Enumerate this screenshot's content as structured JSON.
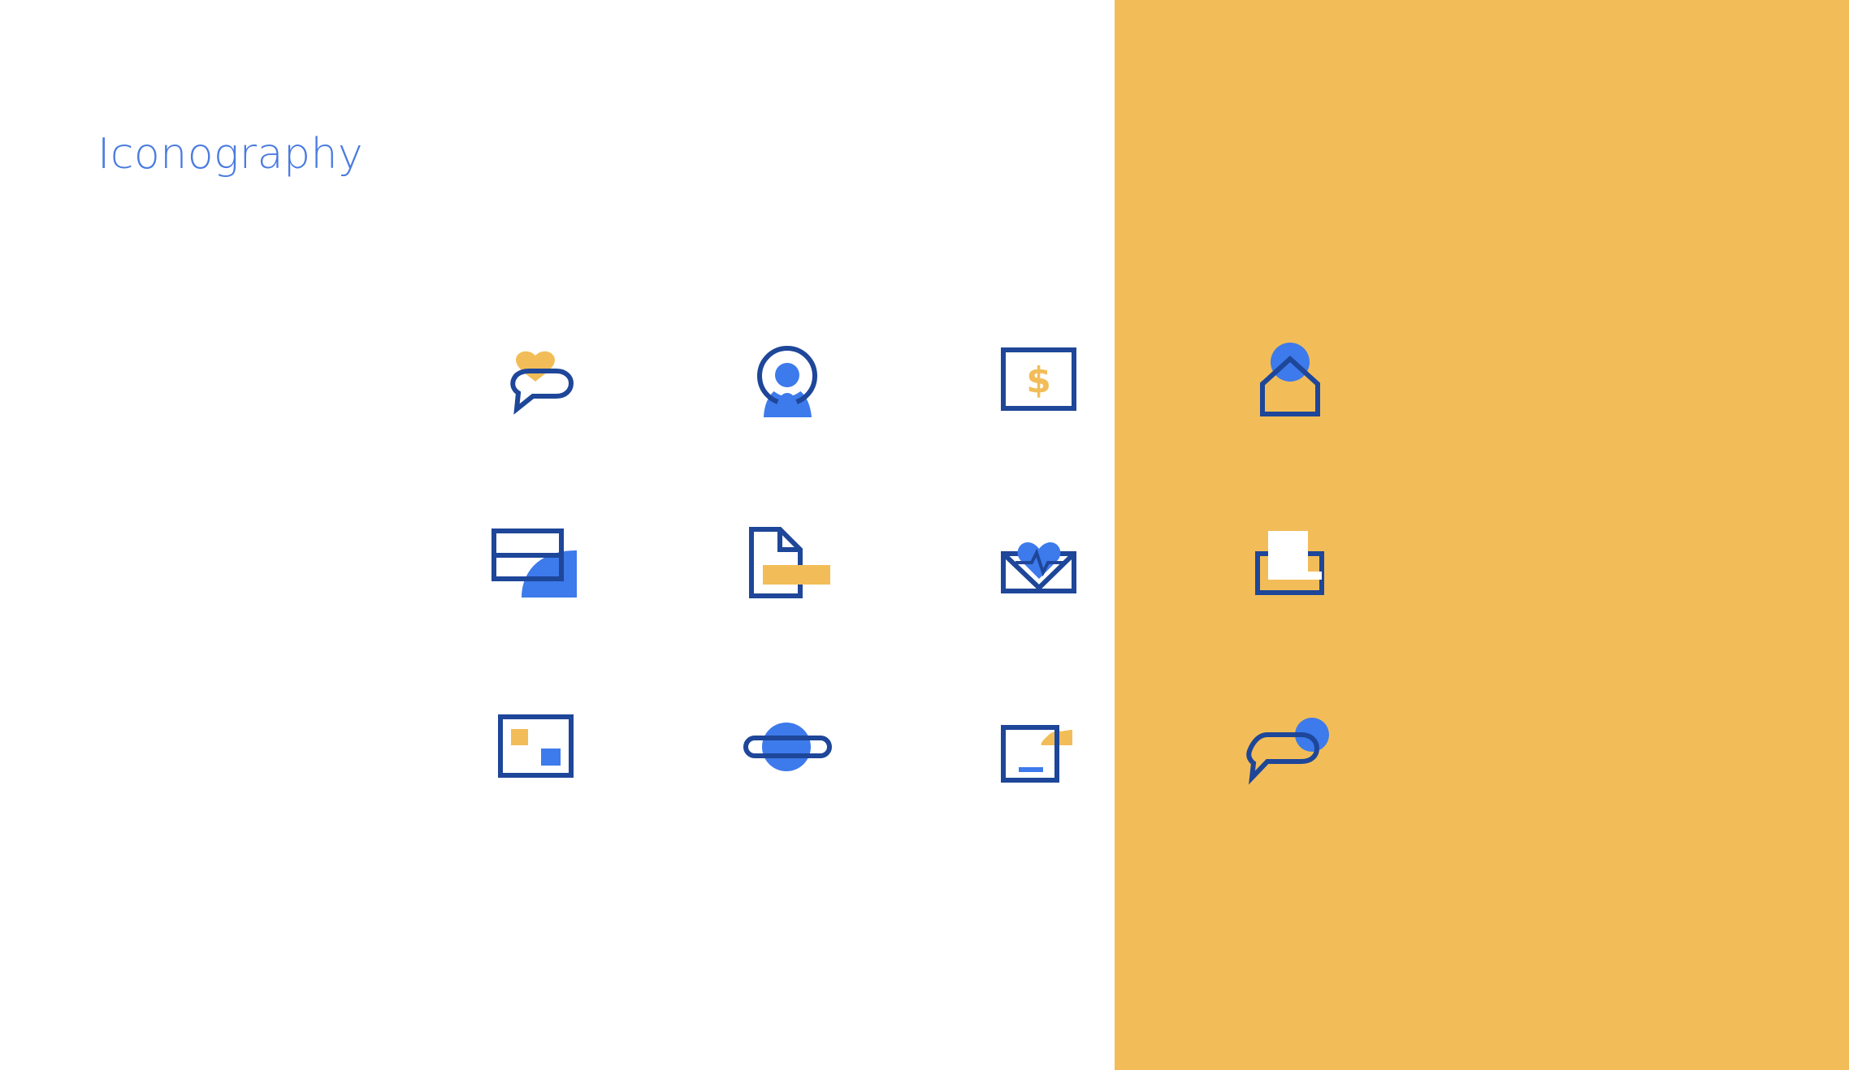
{
  "page": {
    "title": "Iconography"
  },
  "colors": {
    "navy": "#1E4699",
    "blue": "#3D7AEB",
    "yellow": "#F2BD58",
    "white": "#FFFFFF",
    "title": "#4A7BE0",
    "background": "#FFFFFF",
    "panel": "#F2BD58"
  },
  "icons": {
    "row1": [
      "chat-heart-icon",
      "user-avatar-icon",
      "dollar-bill-icon",
      "house-icon"
    ],
    "row2": [
      "credit-card-icon",
      "document-icon",
      "health-envelope-icon",
      "folder-icon"
    ],
    "row3": [
      "picture-frame-icon",
      "planet-icon",
      "note-box-icon",
      "chat-bubble-icon"
    ],
    "dollar_glyph": "$"
  }
}
